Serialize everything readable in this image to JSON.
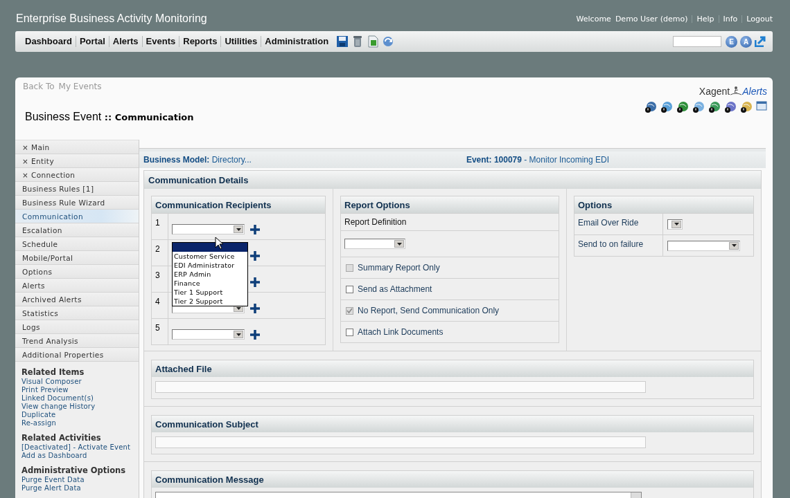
{
  "header": {
    "title": "Enterprise Business Activity Monitoring",
    "welcome": "Welcome",
    "user": "Demo User (demo)",
    "links": [
      "Help",
      "Info",
      "Logout"
    ]
  },
  "nav": {
    "items": [
      "Dashboard",
      "Portal",
      "Alerts",
      "Events",
      "Reports",
      "Utilities",
      "Administration"
    ],
    "buttons": [
      "E",
      "A"
    ]
  },
  "page": {
    "back": "Back To",
    "back_link": "My Events",
    "title": "Business Event",
    "subtitle": ":: Communication",
    "logo_left": "Xagent",
    "logo_right": "Alerts"
  },
  "sidebar": {
    "items": [
      {
        "label": "× Main",
        "selected": false
      },
      {
        "label": "× Entity",
        "selected": false
      },
      {
        "label": "× Connection",
        "selected": false
      },
      {
        "label": "Business Rules [1]",
        "selected": false
      },
      {
        "label": "Business Rule Wizard",
        "selected": false
      },
      {
        "label": "Communication",
        "selected": true
      },
      {
        "label": "Escalation",
        "selected": false
      },
      {
        "label": "Schedule",
        "selected": false
      },
      {
        "label": "Mobile/Portal",
        "selected": false
      },
      {
        "label": "Options",
        "selected": false
      },
      {
        "label": "Alerts",
        "selected": false
      },
      {
        "label": "Archived Alerts",
        "selected": false
      },
      {
        "label": "Statistics",
        "selected": false
      },
      {
        "label": "Logs",
        "selected": false
      },
      {
        "label": "Trend Analysis",
        "selected": false
      },
      {
        "label": "Additional Properties",
        "selected": false
      }
    ],
    "groups": [
      {
        "heading": "Related Items",
        "links": [
          "Visual Composer",
          "Print Preview",
          "Linked Document(s)",
          "View change History",
          "Duplicate",
          "Re-assign"
        ]
      },
      {
        "heading": "Related Activities",
        "links": [
          "[Deactivated] - Activate Event",
          "Add as Dashboard"
        ]
      },
      {
        "heading": "Administrative Options",
        "links": [
          "Purge Event Data",
          "Purge Alert Data"
        ]
      }
    ]
  },
  "info": {
    "model": "**Business Model:** Directory...",
    "event": "**Event: 100079** - Monitor Incoming EDI"
  },
  "details": {
    "title": "Communication Details",
    "recipients": {
      "title": "Communication Recipients",
      "rows": [
        {
          "number": "1",
          "kind": "select"
        },
        {
          "number": "2",
          "kind": "covered"
        },
        {
          "number": "3",
          "kind": "covered"
        },
        {
          "number": "4",
          "kind": "select"
        },
        {
          "number": "5",
          "kind": "select"
        }
      ],
      "dropdown": {
        "blank_selected": true,
        "options": [
          "Customer Service",
          "EDI Administrator",
          "ERP Admin",
          "Finance",
          "Tier 1 Support",
          "Tier 2 Support"
        ]
      }
    },
    "report": {
      "title": "Report Options",
      "definition_label": "Report Definition",
      "checks": [
        {
          "label": "Summary Report Only",
          "checked": false,
          "disabled": true
        },
        {
          "label": "Send as Attachment",
          "checked": false,
          "disabled": false
        },
        {
          "label": "No Report, Send Communication Only",
          "checked": true,
          "disabled": true
        },
        {
          "label": "Attach Link Documents",
          "checked": false,
          "disabled": false
        }
      ]
    },
    "options": {
      "title": "Options",
      "rows": [
        {
          "label": "Email Over Ride",
          "kind": "narrow"
        },
        {
          "label": "Send to on failure",
          "kind": "wide"
        }
      ]
    }
  },
  "sections": [
    {
      "title": "Attached File",
      "kind": "field"
    },
    {
      "title": "Communication Subject",
      "kind": "field"
    },
    {
      "title": "Communication Message",
      "kind": "textarea"
    }
  ]
}
